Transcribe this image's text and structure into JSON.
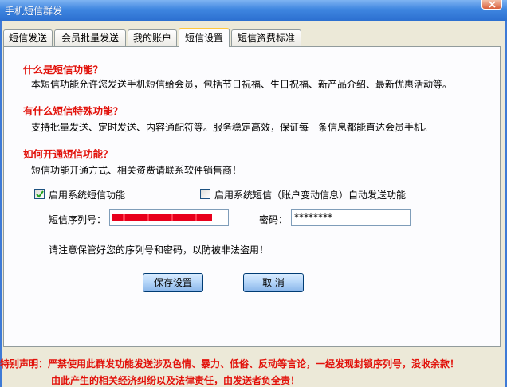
{
  "window": {
    "title": "手机短信群发"
  },
  "tabs": [
    {
      "label": "短信发送"
    },
    {
      "label": "会员批量发送"
    },
    {
      "label": "我的账户"
    },
    {
      "label": "短信设置"
    },
    {
      "label": "短信资费标准"
    }
  ],
  "sections": [
    {
      "heading": "什么是短信功能？",
      "text": "本短信功能允许您发送手机短信给会员，包括节日祝福、生日祝福、新产品介绍、最新优惠活动等。"
    },
    {
      "heading": "有什么短信特殊功能？",
      "text": "支持批量发送、定时发送、内容通配符等。服务稳定高效，保证每一条信息都能直达会员手机。"
    },
    {
      "heading": "如何开通短信功能？",
      "text": "短信功能开通方式、相关资费请联系软件销售商！"
    }
  ],
  "options": {
    "enable_sms": {
      "label": "启用系统短信功能",
      "checked": true
    },
    "auto_send": {
      "label": "启用系统短信（账户变动信息）自动发送功能",
      "checked": false
    }
  },
  "form": {
    "serial_label": "短信序列号：",
    "password_label": "密码：",
    "password_value": "********"
  },
  "notice": "请注意保管好您的序列号和密码，以防被非法盗用！",
  "buttons": {
    "save": "保存设置",
    "cancel": "取 消"
  },
  "footer": {
    "line1": "特别声明：严禁使用此群发功能发送涉及色情、暴力、低俗、反动等言论，一经发现封锁序列号，没收余款！",
    "line2": "由此产生的相关经济纠纷以及法律责任，由发送者负全责！"
  },
  "colors": {
    "heading": "#e2120b",
    "title_bar": "#3f86e0",
    "active_tab_accent": "#ffc83c"
  }
}
